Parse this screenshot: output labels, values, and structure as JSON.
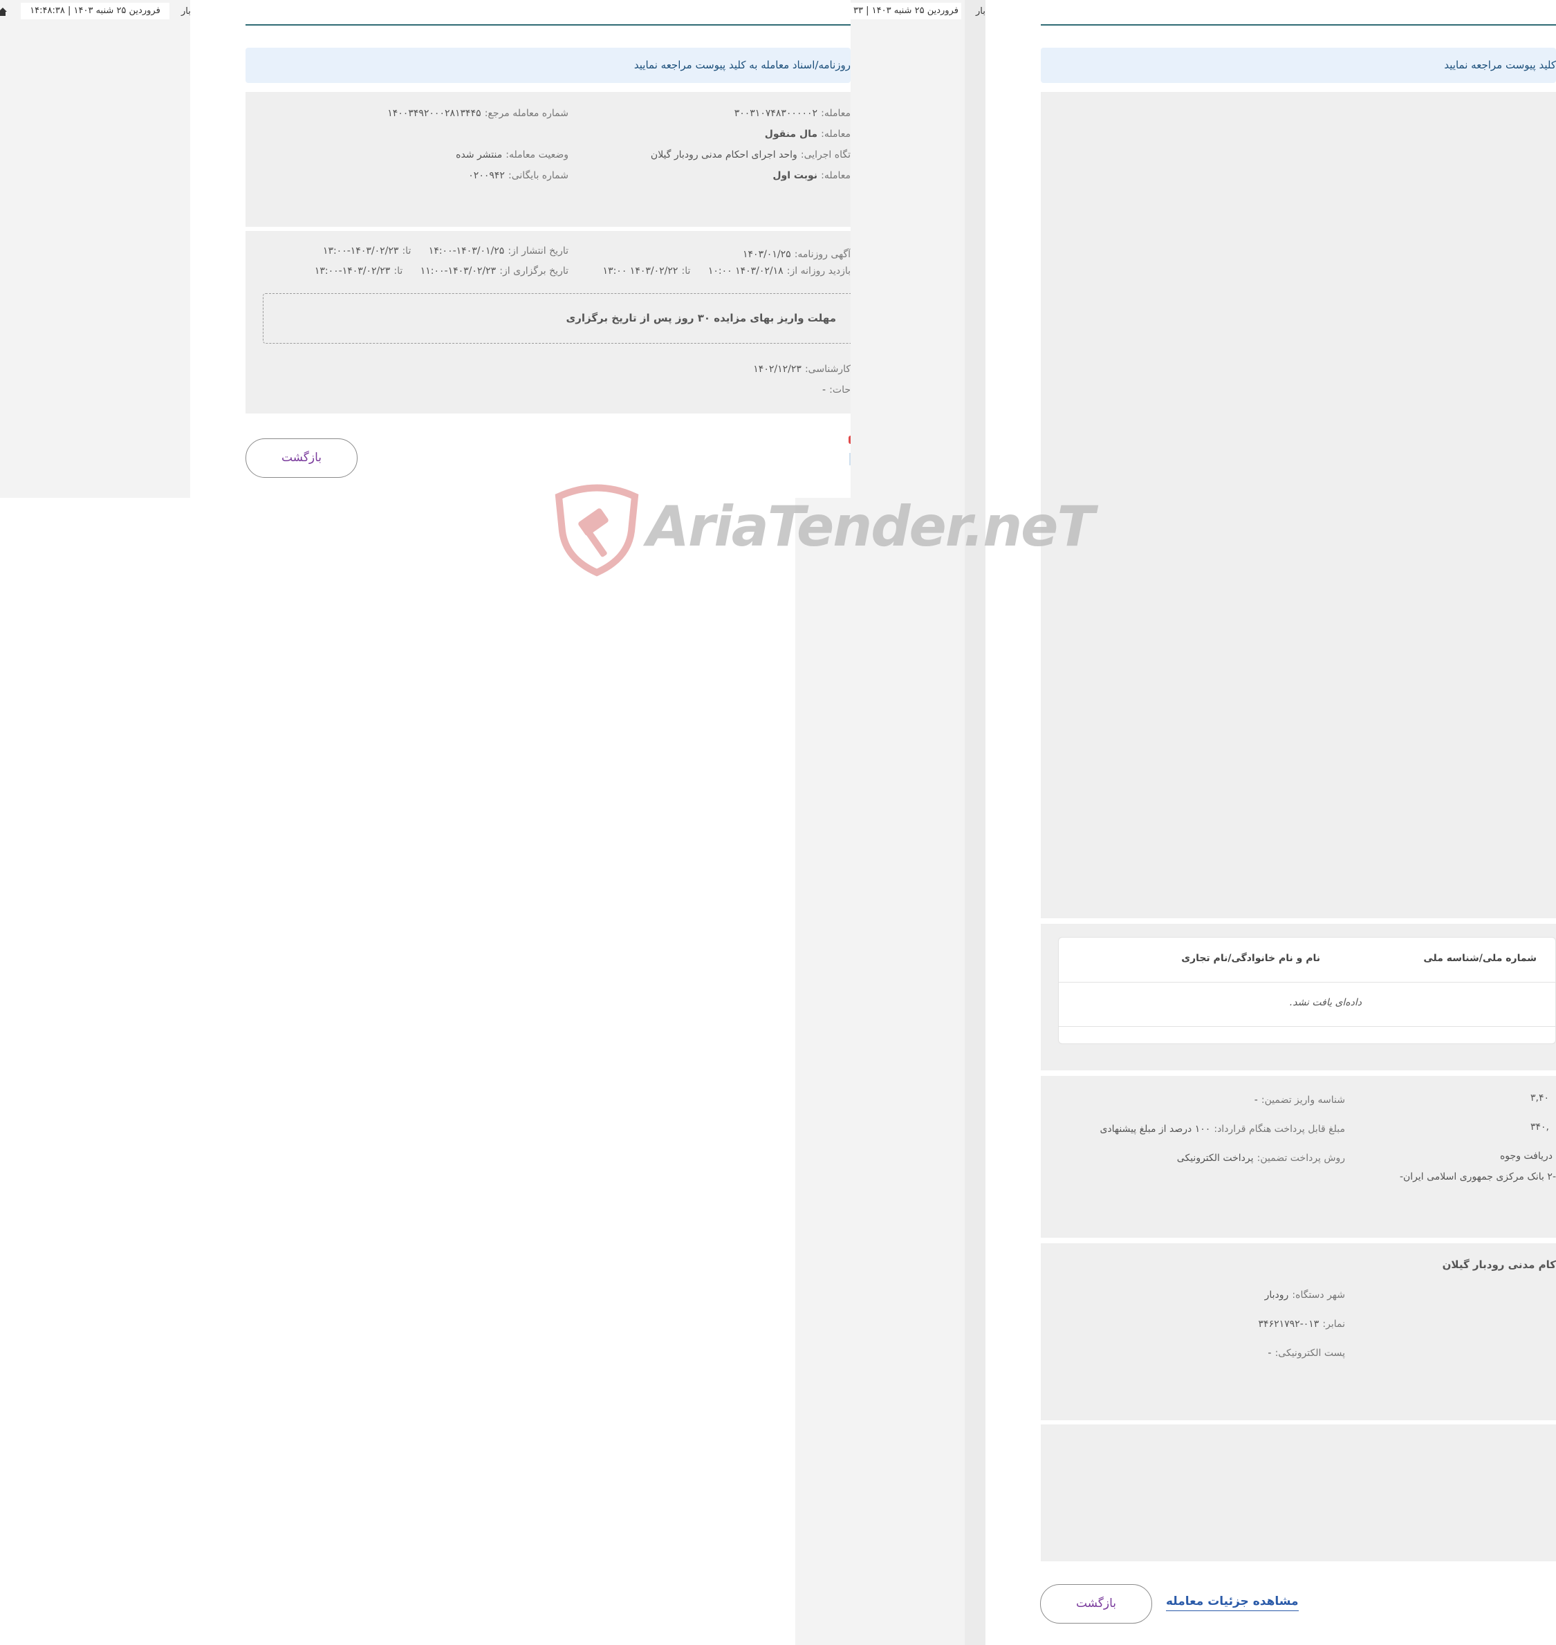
{
  "left": {
    "topbar": {
      "datetime": "فروردین ۲۵ شنبه ۱۴۰۳  |  ۱۴:۴۸:۳۸",
      "edge_text": "بار"
    },
    "info_notice": "روزنامه/اسناد معامله به کلید پیوست مراجعه نمایید",
    "fields": {
      "deal_number": {
        "label": "معامله:",
        "value": "۳۰۰۳۱۰۷۴۸۳۰۰۰۰۰۲"
      },
      "reference_number": {
        "label": "شماره معامله مرجع:",
        "value": "۱۴۰۰۳۴۹۲۰۰۰۲۸۱۳۴۴۵"
      },
      "deal_subject": {
        "label": "معامله:",
        "value": "مال منقول"
      },
      "deal_status": {
        "label": "وضعیت معامله:",
        "value": "منتشر شده"
      },
      "executive": {
        "label": "تگاه اجرایی:",
        "value": "واحد اجرای احکام مدنی رودبار گیلان"
      },
      "archive_number": {
        "label": "شماره بایگانی:",
        "value": "۰۲۰۰۹۴۲"
      },
      "deal_round": {
        "label": "معامله:",
        "value": "نوبت اول"
      }
    },
    "dates": {
      "newspaper": {
        "label": "آگهی روزنامه:",
        "value": "۱۴۰۳/۰۱/۲۵"
      },
      "publish_from": {
        "label": "تاریخ انتشار از:",
        "value": "۱۴۰۳/۰۱/۲۵-۱۴:۰۰"
      },
      "publish_to": {
        "label": "تا:",
        "value": "۱۴۰۳/۰۲/۲۳-۱۳:۰۰"
      },
      "visit_from": {
        "label": "بازدید روزانه از:",
        "value": "۱۴۰۳/۰۲/۱۸  ۱۰:۰۰"
      },
      "visit_to": {
        "label": "تا:",
        "value": "۱۴۰۳/۰۲/۲۲  ۱۳:۰۰"
      },
      "hold_from": {
        "label": "تاریخ برگزاری از:",
        "value": "۱۴۰۳/۰۲/۲۳-۱۱:۰۰"
      },
      "hold_to": {
        "label": "تا:",
        "value": "۱۴۰۳/۰۲/۲۳-۱۳:۰۰"
      }
    },
    "notice_box": "مهلت واریز بهای مزایده ۳۰ روز پس از تاریخ برگزاری",
    "expert": {
      "label": "کارشناسی:",
      "value": "۱۴۰۲/۱۲/۲۳"
    },
    "notes": {
      "label": "حات:",
      "value": "-"
    },
    "back_button": "بازگشت"
  },
  "right": {
    "topbar": {
      "datetime": "فروردین ۲۵ شنبه ۱۴۰۳  |  ۳۳",
      "edge_text": "بار"
    },
    "info_notice": "کلید پیوست مراجعه نمایید",
    "table": {
      "headers": [
        "شماره ملی/شناسه ملی",
        "نام و نام خانوادگی/نام تجاری"
      ],
      "empty_text": "داده‌ای یافت نشد."
    },
    "guarantee": {
      "deposit_id": {
        "label": "شناسه واریز تضمین:",
        "value": "-"
      },
      "contract_payment": {
        "label": "مبلغ قابل پرداخت هنگام قرارداد:",
        "value": "۱۰۰ درصد از مبلغ پیشنهادی"
      },
      "payment_method": {
        "label": "روش پرداخت تضمین:",
        "value": "پرداخت الکترونیکی"
      },
      "amount1": "۳,۴۰",
      "amount2": "۳۴۰,",
      "receipt": "دریافت وجوه",
      "bank": "-۲ بانک مرکزی جمهوری اسلامی ایران-"
    },
    "contact": {
      "org_name": "کام مدنی رودبار گیلان",
      "city": {
        "label": "شهر دستگاه:",
        "value": "رودبار"
      },
      "fax": {
        "label": "نمابر:",
        "value": "۰۱۳-۳۴۶۲۱۷۹۲"
      },
      "email": {
        "label": "پست الکترونیکی:",
        "value": "-"
      }
    },
    "details_link": "مشاهده جزئیات معامله",
    "back_button": "بازگشت"
  },
  "watermark": {
    "text": "AriaTender.neT"
  }
}
